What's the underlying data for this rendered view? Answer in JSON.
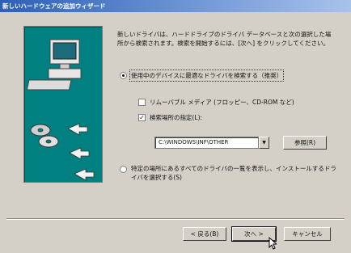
{
  "window": {
    "title": "新しいハードウェアの追加ウィザード"
  },
  "intro_text": "新しいドライバは、ハードドライブのドライバ データベースと次の選択した場所から検索されます。検索を開始するには、[次へ] をクリックしてください。",
  "options": {
    "search": {
      "label": "使用中のデバイスに最適なドライバを検索する（推奨）",
      "selected": true
    },
    "removable": {
      "label": "リムーバブル メディア (フロッピー、CD-ROM など)",
      "checked": false
    },
    "specify_location": {
      "label": "検索場所の指定(L):",
      "checked": true
    },
    "path_value": "C:\\WINDOWS\\INF\\OTHER",
    "browse_label": "参照(R)",
    "list": {
      "label": "特定の場所にあるすべてのドライバの一覧を表示し、インストールするドライバを選択する(S)",
      "selected": false
    }
  },
  "buttons": {
    "back": "< 戻る(B)",
    "next": "次へ >",
    "cancel": "キャンセル"
  },
  "icons": {
    "computer": "computer-icon",
    "disks": "cd-disk-icon",
    "arrows": "arrow-icon",
    "cursor": "mouse-cursor-icon"
  }
}
